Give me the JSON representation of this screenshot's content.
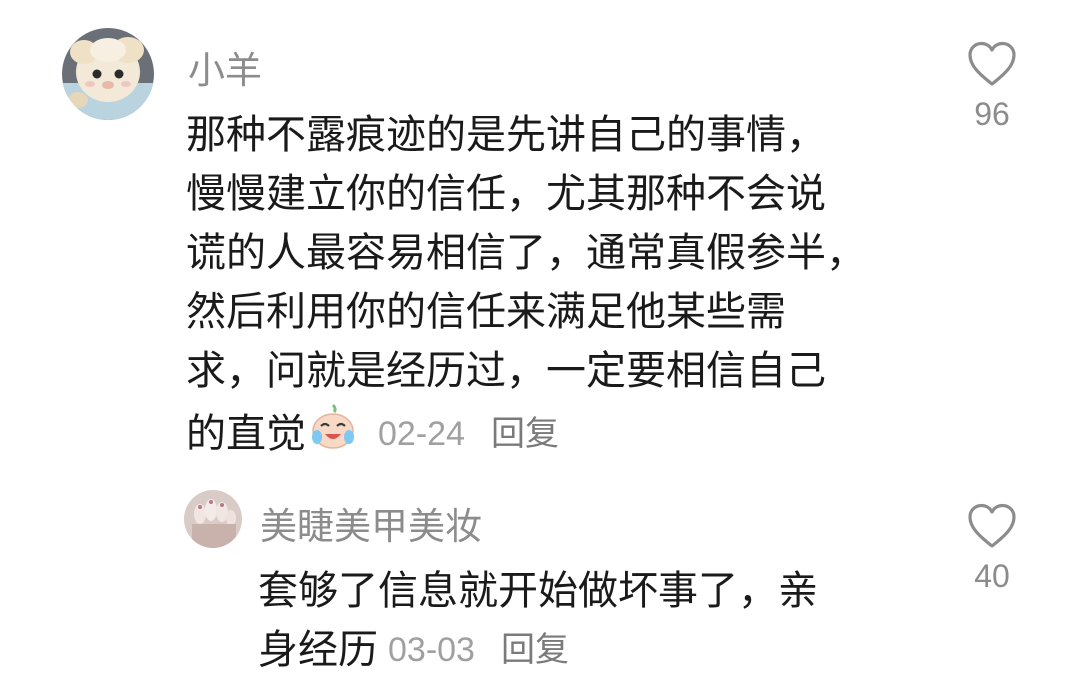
{
  "comments": [
    {
      "username": "小羊",
      "text_lines": [
        "那种不露痕迹的是先讲自己的事情，",
        "慢慢建立你的信任，尤其那种不会说",
        "谎的人最容易相信了，通常真假参半，",
        "然后利用你的信任来满足他某些需",
        "求，问就是经历过，一定要相信自己",
        "的直觉"
      ],
      "emoji": "crying-laughing-face",
      "date": "02-24",
      "reply_label": "回复",
      "likes": "96",
      "avatar": "plush-toy-avatar"
    },
    {
      "username": "美睫美甲美妆",
      "text_lines": [
        "套够了信息就开始做坏事了，亲",
        "身经历"
      ],
      "date": "03-03",
      "reply_label": "回复",
      "likes": "40",
      "avatar": "manicure-nails-avatar"
    }
  ],
  "colors": {
    "username": "#8c8c8c",
    "text": "#1a1a1a",
    "date": "#a0a0a0",
    "heart": "#8c8c8c"
  }
}
